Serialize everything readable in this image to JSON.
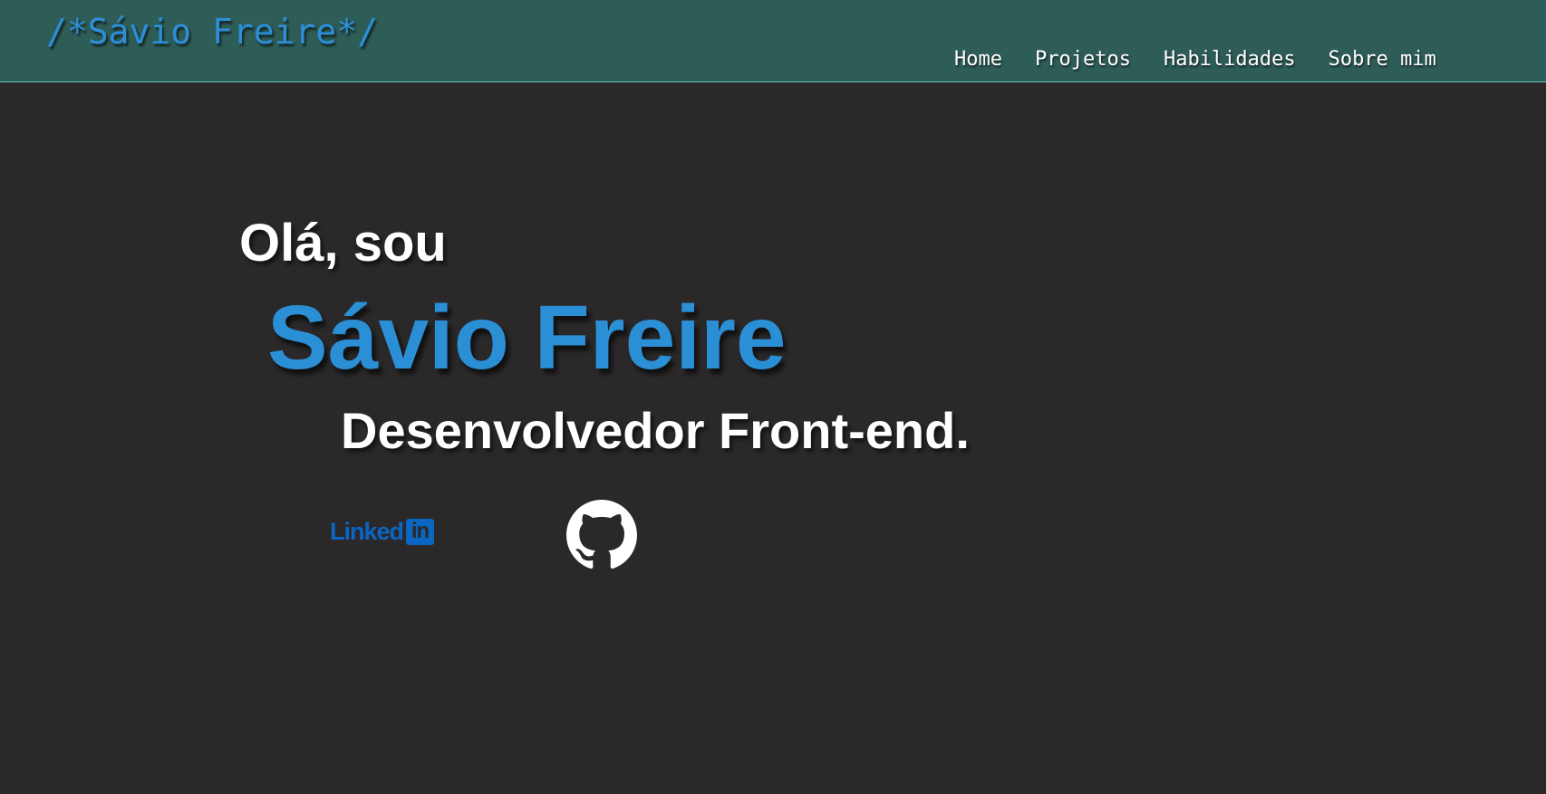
{
  "header": {
    "logo": "/*Sávio Freire*/",
    "nav": [
      {
        "label": "Home"
      },
      {
        "label": "Projetos"
      },
      {
        "label": "Habilidades"
      },
      {
        "label": "Sobre mim"
      }
    ]
  },
  "hero": {
    "greeting": "Olá, sou",
    "name": "Sávio Freire",
    "role": "Desenvolvedor Front-end."
  },
  "social": {
    "linkedin_text": "Linked",
    "linkedin_box": "in",
    "linkedin_icon": "linkedin-logo",
    "github_icon": "github-logo"
  },
  "colors": {
    "header_bg": "#2e5c57",
    "page_bg": "#2a2829",
    "accent": "#2b8fd6",
    "linkedin": "#0a66c2"
  }
}
